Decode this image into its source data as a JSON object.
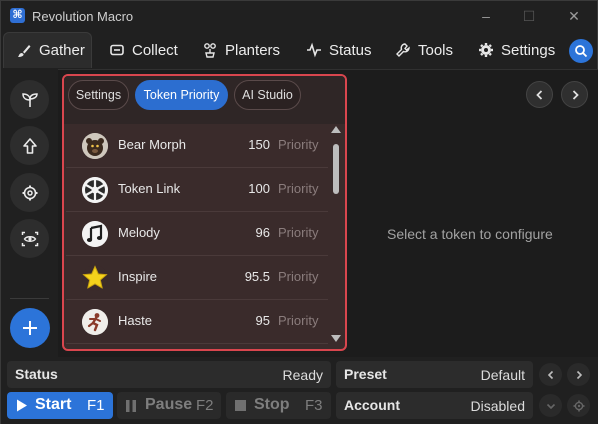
{
  "app": {
    "title": "Revolution Macro"
  },
  "nav": {
    "tabs": [
      {
        "label": "Gather",
        "icon": "brush-icon"
      },
      {
        "label": "Collect",
        "icon": "box-icon"
      },
      {
        "label": "Planters",
        "icon": "planter-icon"
      },
      {
        "label": "Status",
        "icon": "pulse-icon"
      },
      {
        "label": "Tools",
        "icon": "wrench-icon"
      },
      {
        "label": "Settings",
        "icon": "gear-icon"
      }
    ]
  },
  "subtabs": [
    "Settings",
    "Token Priority",
    "AI Studio"
  ],
  "tokens": [
    {
      "name": "Bear Morph",
      "value": "150",
      "unit": "Priority"
    },
    {
      "name": "Token Link",
      "value": "100",
      "unit": "Priority"
    },
    {
      "name": "Melody",
      "value": "96",
      "unit": "Priority"
    },
    {
      "name": "Inspire",
      "value": "95.5",
      "unit": "Priority"
    },
    {
      "name": "Haste",
      "value": "95",
      "unit": "Priority"
    }
  ],
  "placeholder": "Select a token to configure",
  "bottom": {
    "status_label": "Status",
    "status_value": "Ready",
    "preset_label": "Preset",
    "preset_value": "Default",
    "account_label": "Account",
    "account_value": "Disabled",
    "start_label": "Start",
    "start_key": "F1",
    "pause_label": "Pause",
    "pause_key": "F2",
    "stop_label": "Stop",
    "stop_key": "F3"
  },
  "colors": {
    "accent": "#2c74d9",
    "highlight_border": "#d9464e"
  }
}
